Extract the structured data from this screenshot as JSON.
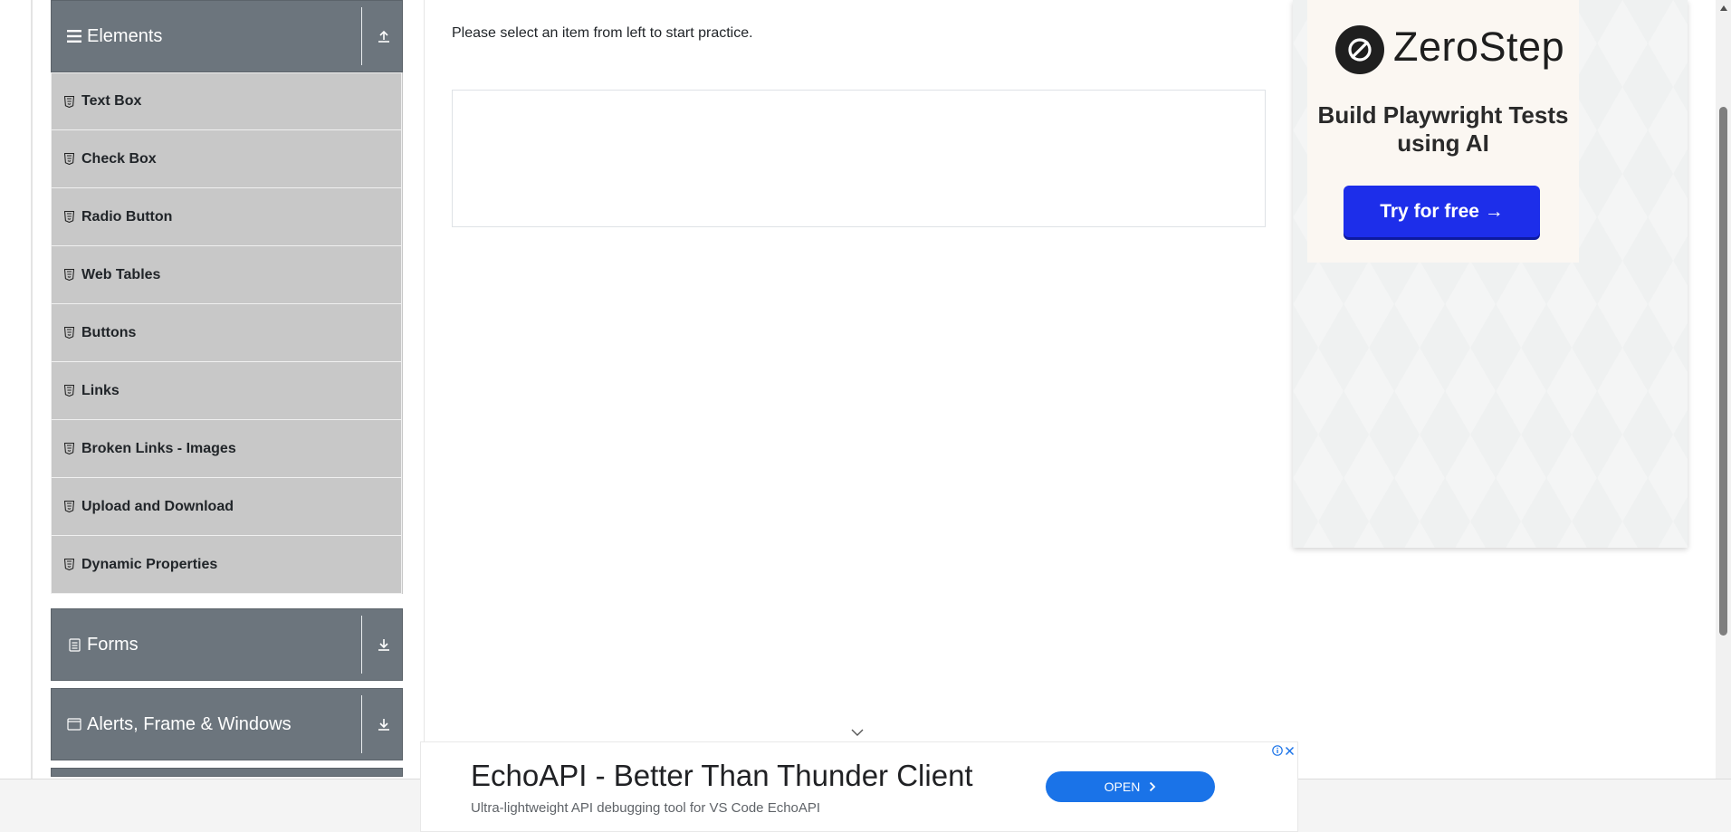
{
  "sidebar": {
    "elements_group": {
      "title": "Elements",
      "items": [
        {
          "label": "Text Box"
        },
        {
          "label": "Check Box"
        },
        {
          "label": "Radio Button"
        },
        {
          "label": "Web Tables"
        },
        {
          "label": "Buttons"
        },
        {
          "label": "Links"
        },
        {
          "label": "Broken Links - Images"
        },
        {
          "label": "Upload and Download"
        },
        {
          "label": "Dynamic Properties"
        }
      ]
    },
    "forms_group": {
      "title": "Forms"
    },
    "alerts_group": {
      "title": "Alerts, Frame & Windows"
    }
  },
  "main": {
    "instruction": "Please select an item from left to start practice."
  },
  "right_ad": {
    "brand": "ZeroStep",
    "tagline": "Build Playwright Tests using AI",
    "cta": "Try for free →",
    "cta_color": "#1d2eea"
  },
  "bottom_ad": {
    "headline": "EchoAPI - Better Than Thunder Client",
    "description": "Ultra-lightweight API debugging tool for VS Code EchoAPI",
    "button": "OPEN",
    "button_color": "#1a73e8"
  },
  "colors": {
    "group_header": "#6c757d",
    "menu_item": "#c8c8c8"
  }
}
